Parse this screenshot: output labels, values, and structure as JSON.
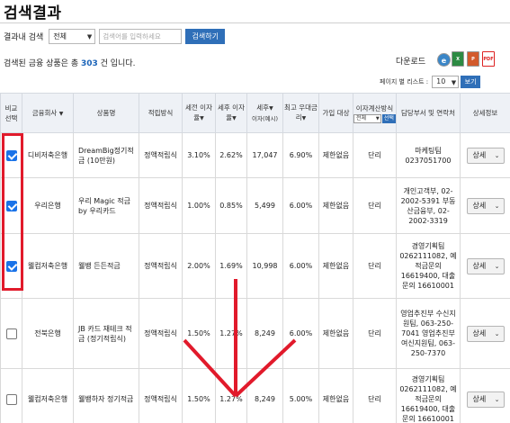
{
  "page": {
    "title": "검색결과"
  },
  "search": {
    "label": "결과내 검색",
    "scope_value": "전체",
    "placeholder": "검색어를 입력하세요",
    "button": "검색하기"
  },
  "result": {
    "prefix": "검색된 금융 상품은 총 ",
    "count": "303",
    "suffix": " 건 입니다."
  },
  "download": {
    "label": "다운로드",
    "icons": [
      "ie-icon",
      "excel-icon",
      "powerpoint-icon",
      "pdf-icon"
    ]
  },
  "perpage": {
    "label": "페이지 별 리스트 :",
    "value": "10",
    "button": "보기"
  },
  "table": {
    "headers": {
      "compare": "비교 선택",
      "company": "금융회사",
      "product": "상품명",
      "method": "적립방식",
      "pretax": "세전 이자율",
      "posttax": "세후 이자율",
      "posttax_amount_1": "세후",
      "posttax_amount_2": "이자(예시)",
      "max_rate": "최고 우대금리",
      "target": "가입 대상",
      "calc": "이자계산방식",
      "calc_select": "전체",
      "calc_button": "선택",
      "contact": "담당부서 및 연락처",
      "detail": "상세정보"
    },
    "sort_marker": "▼",
    "rows": [
      {
        "checked": true,
        "company": "디비저축은행",
        "product": "DreamBig정기적금 (10만원)",
        "method": "정액적립식",
        "pretax": "3.10%",
        "posttax": "2.62%",
        "amount": "17,047",
        "max_rate": "6.90%",
        "target": "제한없음",
        "calc": "단리",
        "contact": "마케팅팀 0237051700",
        "detail": "상세"
      },
      {
        "checked": true,
        "company": "우리은행",
        "product": "우리 Magic 적금 by 우리카드",
        "method": "정액적립식",
        "pretax": "1.00%",
        "posttax": "0.85%",
        "amount": "5,499",
        "max_rate": "6.00%",
        "target": "제한없음",
        "calc": "단리",
        "contact": "개인고객부, 02-2002-5391 부동산금융부, 02-2002-3319",
        "detail": "상세"
      },
      {
        "checked": true,
        "company": "웰컴저축은행",
        "product": "웰뱅 든든적금",
        "method": "정액적립식",
        "pretax": "2.00%",
        "posttax": "1.69%",
        "amount": "10,998",
        "max_rate": "6.00%",
        "target": "제한없음",
        "calc": "단리",
        "contact": "경영기획팀 0262111082, 예적금문의 16619400, 대출문의 16610001",
        "detail": "상세"
      },
      {
        "checked": false,
        "company": "전북은행",
        "product": "JB 카드 재테크 적금 (정기적립식)",
        "method": "정액적립식",
        "pretax": "1.50%",
        "posttax": "1.27%",
        "amount": "8,249",
        "max_rate": "6.00%",
        "target": "제한없음",
        "calc": "단리",
        "contact": "영업추진부 수신지원팀, 063-250-7041 영업추진부 여신지원팀, 063-250-7370",
        "detail": "상세"
      },
      {
        "checked": false,
        "company": "웰컴저축은행",
        "product": "웰뱅하자 정기적금",
        "method": "정액적립식",
        "pretax": "1.50%",
        "posttax": "1.27%",
        "amount": "8,249",
        "max_rate": "5.00%",
        "target": "제한없음",
        "calc": "단리",
        "contact": "경영기획팀 0262111082, 예적금문의 16619400, 대출문의 16610001",
        "detail": "상세"
      }
    ]
  },
  "annotations": {
    "highlight_color": "#e11a2b"
  }
}
